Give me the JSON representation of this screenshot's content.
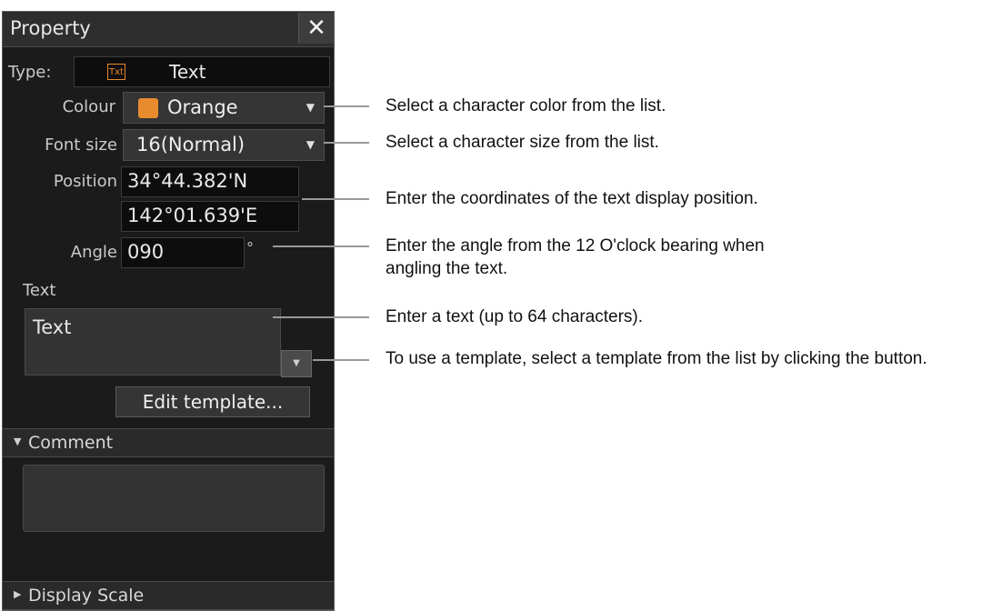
{
  "panel": {
    "title": "Property",
    "close_glyph": "✕",
    "type_label": "Type:",
    "type_icon_text": "Txt",
    "type_value": "Text",
    "colour_label": "Colour",
    "colour_value": "Orange",
    "colour_swatch": "#e88a2e",
    "font_size_label": "Font size",
    "font_size_value": "16(Normal)",
    "position_label": "Position",
    "latitude": "34°44.382'N",
    "longitude": "142°01.639'E",
    "angle_label": "Angle",
    "angle_value": "090",
    "angle_unit": "°",
    "text_label": "Text",
    "text_value": "Text",
    "edit_template_label": "Edit template...",
    "comment_section": "Comment",
    "display_scale_section": "Display Scale"
  },
  "annotations": [
    "Select a character color from the list.",
    "Select a character size from the list.",
    "Enter the coordinates of the text display position.",
    "Enter the angle from the 12 O'clock bearing when angling the text.",
    "Enter a text (up to 64 characters).",
    "To use a template, select a template from the list by clicking the button."
  ]
}
